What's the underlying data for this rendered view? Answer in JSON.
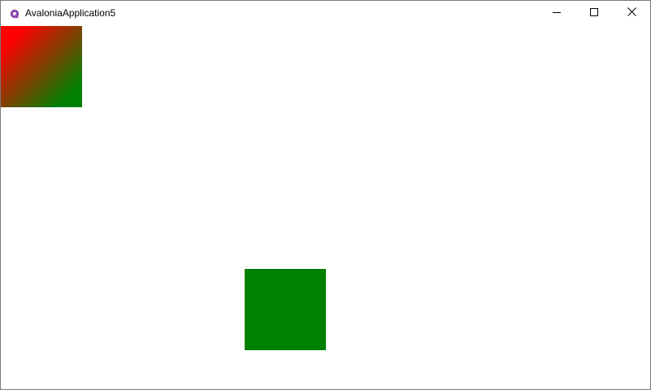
{
  "window": {
    "title": "AvaloniaApplication5",
    "app_icon": "avalonia-logo-icon",
    "accent_color": "#8b44ac",
    "controls": {
      "minimize_icon": "minimize-icon",
      "maximize_icon": "maximize-icon",
      "close_icon": "close-icon"
    }
  },
  "canvas": {
    "gradient_rectangle": {
      "start_color": "#ff0000",
      "end_color": "#008000"
    },
    "solid_rectangle": {
      "color": "#008000"
    }
  }
}
